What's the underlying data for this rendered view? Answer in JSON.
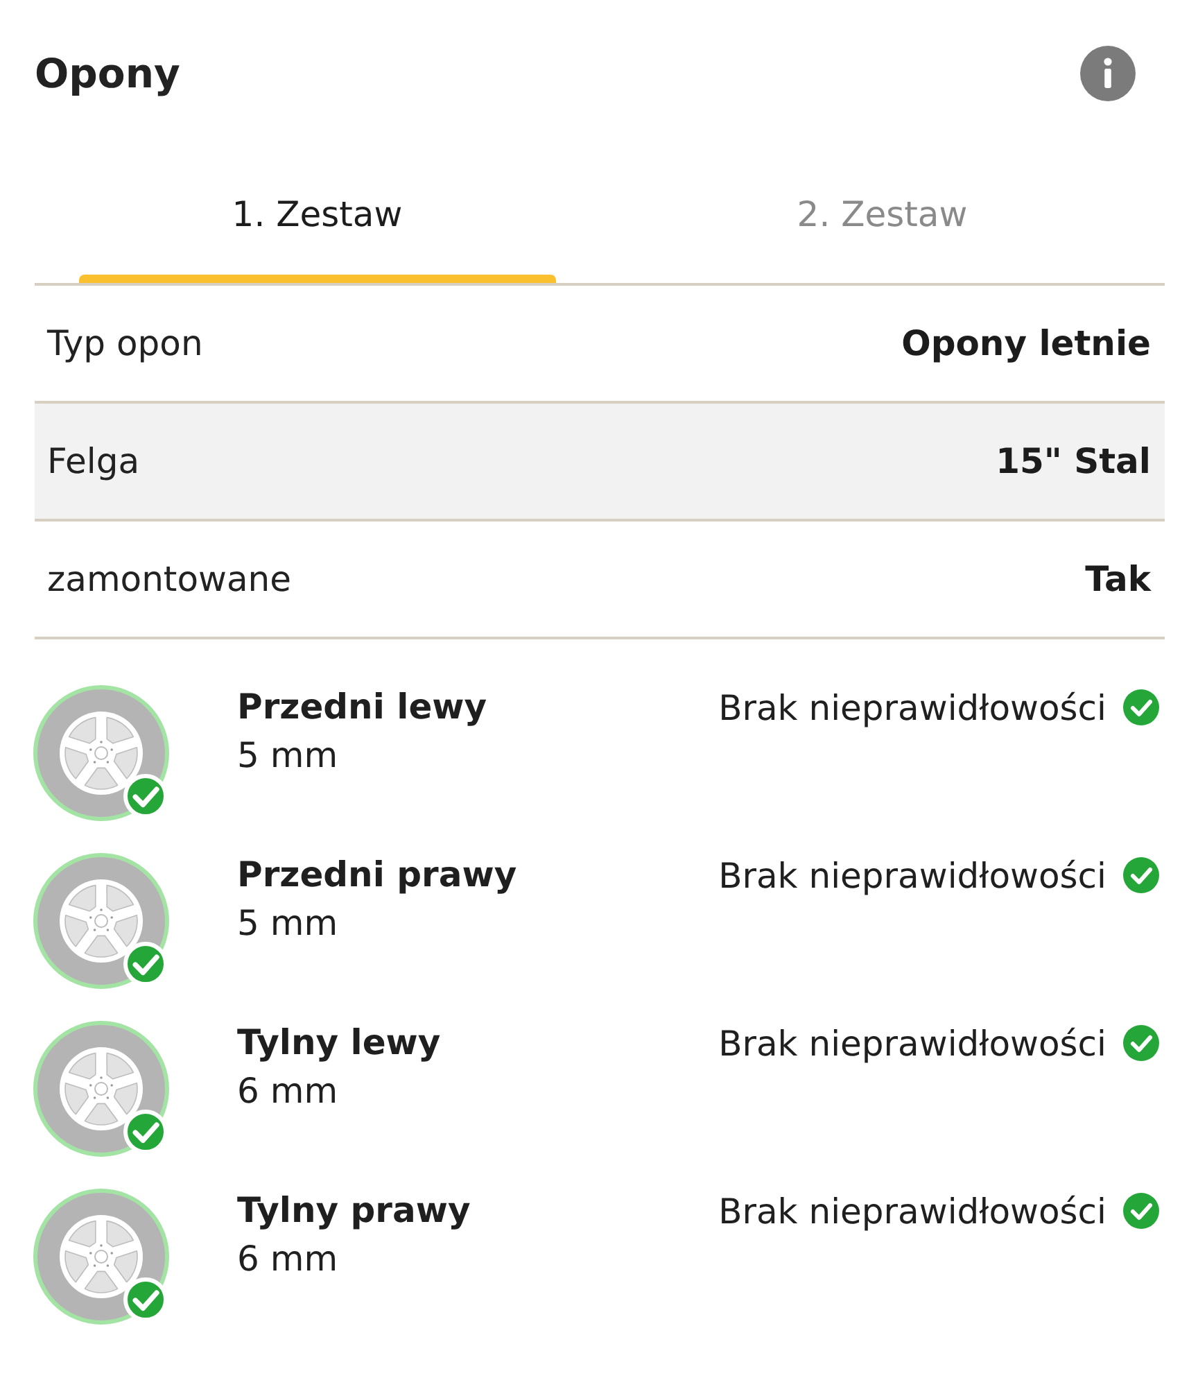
{
  "header": {
    "title": "Opony"
  },
  "tabs": [
    {
      "label": "1. Zestaw",
      "selected": true
    },
    {
      "label": "2. Zestaw",
      "selected": false
    }
  ],
  "details": [
    {
      "label": "Typ opon",
      "value": "Opony letnie"
    },
    {
      "label": "Felga",
      "value": "15\" Stal"
    },
    {
      "label": "zamontowane",
      "value": "Tak"
    }
  ],
  "tires": [
    {
      "name": "Przedni lewy",
      "depth": "5 mm",
      "status": "Brak nieprawidłowości"
    },
    {
      "name": "Przedni prawy",
      "depth": "5 mm",
      "status": "Brak nieprawidłowości"
    },
    {
      "name": "Tylny lewy",
      "depth": "6 mm",
      "status": "Brak nieprawidłowości"
    },
    {
      "name": "Tylny prawy",
      "depth": "6 mm",
      "status": "Brak nieprawidłowości"
    }
  ]
}
